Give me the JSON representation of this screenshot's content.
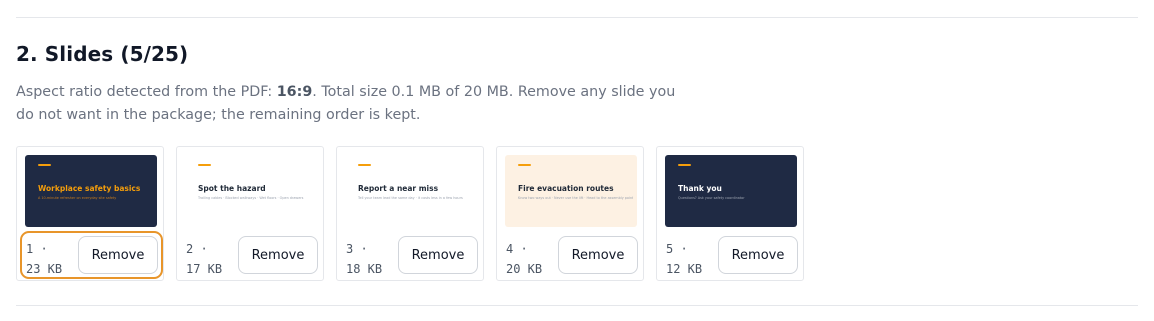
{
  "section": {
    "title": "2. Slides (5/25)",
    "desc_prefix": "Aspect ratio detected from the PDF: ",
    "aspect_ratio": "16:9",
    "desc_suffix": ". Total size 0.1 MB of 20 MB. Remove any slide you do not want in the package; the remaining order is kept."
  },
  "slides": [
    {
      "number": "1 ·",
      "size": "23 KB",
      "title": "Workplace safety basics",
      "subtitle": "A 10-minute refresher on everyday site safety",
      "theme": "dark-title",
      "remove_label": "Remove",
      "focused": true
    },
    {
      "number": "2 ·",
      "size": "17 KB",
      "title": "Spot the hazard",
      "subtitle": "Trailing cables · Blocked walkways · Wet floors · Open drawers",
      "theme": "light",
      "remove_label": "Remove",
      "focused": false
    },
    {
      "number": "3 ·",
      "size": "18 KB",
      "title": "Report a near miss",
      "subtitle": "Tell your team lead the same day · it costs less in a few hours",
      "theme": "light",
      "remove_label": "Remove",
      "focused": false
    },
    {
      "number": "4 ·",
      "size": "20 KB",
      "title": "Fire evacuation routes",
      "subtitle": "Know two ways out · Never use the lift · Head to the assembly point",
      "theme": "cream",
      "remove_label": "Remove",
      "focused": false
    },
    {
      "number": "5 ·",
      "size": "12 KB",
      "title": "Thank you",
      "subtitle": "Questions? Ask your safety coordinator",
      "theme": "dark",
      "remove_label": "Remove",
      "focused": false
    }
  ],
  "colors": {
    "accent": "#f59e0b",
    "focus_ring": "#e8952a",
    "dark_slide": "#1f2a44",
    "cream_slide": "#fdf1e3"
  }
}
